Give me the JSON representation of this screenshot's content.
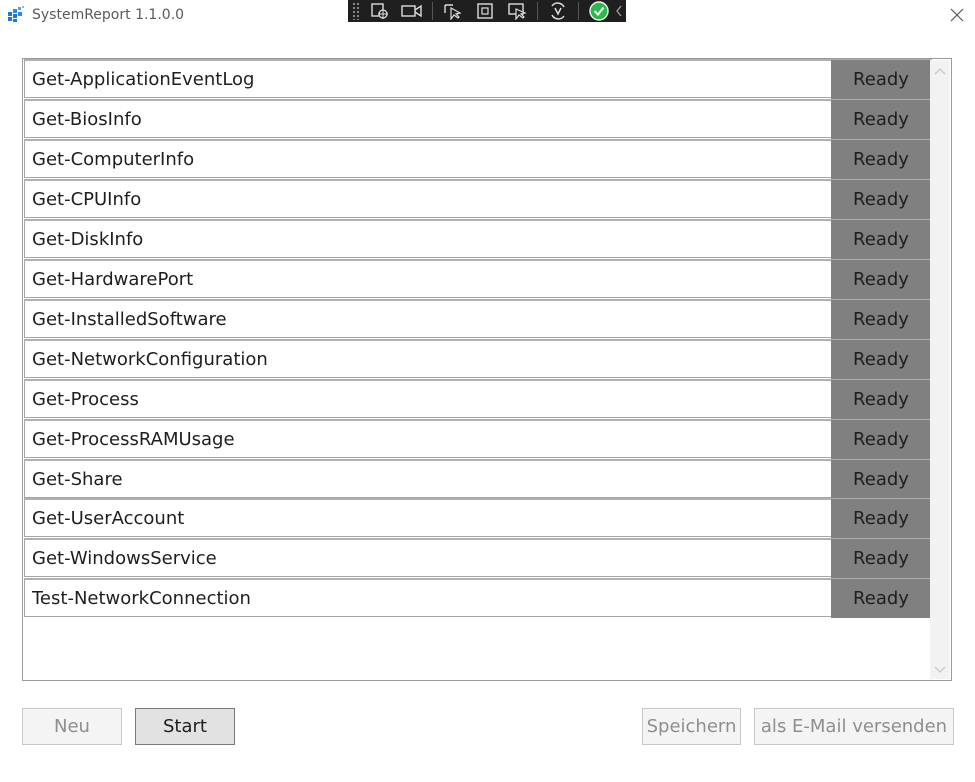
{
  "window": {
    "title": "SystemReport 1.1.0.0",
    "close_glyph": "✕"
  },
  "debug_toolbar": {
    "buttons": [
      "select-element-icon",
      "record-icon",
      "pointer-icon",
      "frame-icon",
      "track-focus-icon",
      "hot-reload-icon",
      "ok-check-icon",
      "collapse-chevron-icon"
    ]
  },
  "tasks": [
    {
      "name": "Get-ApplicationEventLog",
      "status": "Ready"
    },
    {
      "name": "Get-BiosInfo",
      "status": "Ready"
    },
    {
      "name": "Get-ComputerInfo",
      "status": "Ready"
    },
    {
      "name": "Get-CPUInfo",
      "status": "Ready"
    },
    {
      "name": "Get-DiskInfo",
      "status": "Ready"
    },
    {
      "name": "Get-HardwarePort",
      "status": "Ready"
    },
    {
      "name": "Get-InstalledSoftware",
      "status": "Ready"
    },
    {
      "name": "Get-NetworkConfiguration",
      "status": "Ready"
    },
    {
      "name": "Get-Process",
      "status": "Ready"
    },
    {
      "name": "Get-ProcessRAMUsage",
      "status": "Ready"
    },
    {
      "name": "Get-Share",
      "status": "Ready"
    },
    {
      "name": "Get-UserAccount",
      "status": "Ready"
    },
    {
      "name": "Get-WindowsService",
      "status": "Ready"
    },
    {
      "name": "Test-NetworkConnection",
      "status": "Ready"
    }
  ],
  "buttons": {
    "new_label": "Neu",
    "start_label": "Start",
    "save_label": "Speichern",
    "email_label": "als E-Mail versenden"
  },
  "colors": {
    "status_bg": "#808080",
    "checkmark_green": "#2db84b"
  }
}
